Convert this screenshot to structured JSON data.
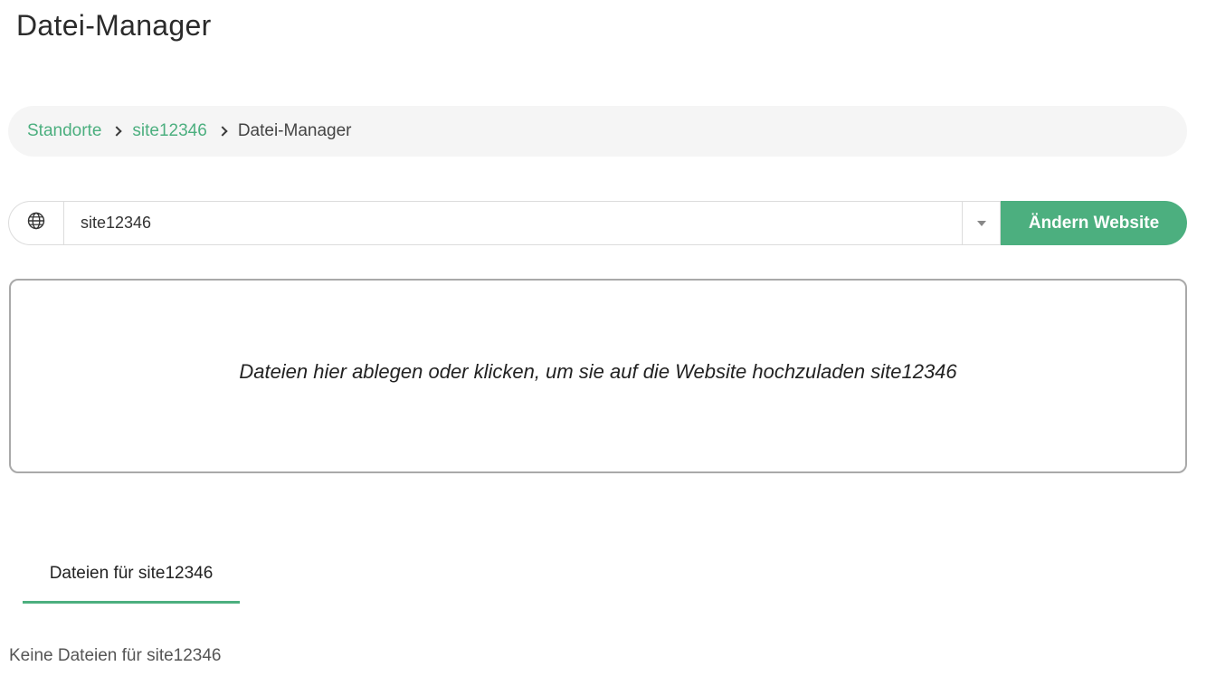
{
  "page": {
    "title": "Datei-Manager"
  },
  "breadcrumb": {
    "items": [
      {
        "label": "Standorte",
        "link": true
      },
      {
        "label": "site12346",
        "link": true
      },
      {
        "label": "Datei-Manager",
        "link": false
      }
    ]
  },
  "site_selector": {
    "icon": "globe-icon",
    "selected_value": "site12346",
    "button_label": "Ändern Website"
  },
  "dropzone": {
    "text": "Dateien hier ablegen oder klicken, um sie auf die Website hochzuladen site12346"
  },
  "tabs": [
    {
      "label": "Dateien für site12346",
      "active": true
    }
  ],
  "files": {
    "empty_message": "Keine Dateien für site12346"
  },
  "colors": {
    "accent": "#4caf7f",
    "breadcrumb_bg": "#f5f5f5",
    "border": "#dcdcdc"
  }
}
